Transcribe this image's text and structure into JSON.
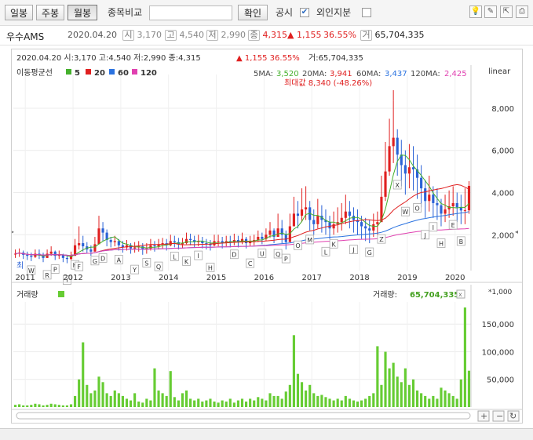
{
  "toolbar": {
    "tabs": [
      "일봉",
      "주봉",
      "월봉"
    ],
    "active_tab": "월봉",
    "compare_label": "종목비교",
    "compare_value": "",
    "confirm_label": "확인",
    "disclosure_label": "공시",
    "disclosure_checked": "✔",
    "foreign_label": "외인지분"
  },
  "quote": {
    "name": "우수AMS",
    "date": "2020.04.20",
    "open_icon": "시",
    "open": "3,170",
    "high_icon": "고",
    "high": "4,540",
    "low_icon": "저",
    "low": "2,990",
    "close_icon": "종",
    "close": "4,315",
    "change": "▲ 1,155",
    "change_pct": "36.55%",
    "volume_icon": "거",
    "volume": "65,704,335"
  },
  "chart_header": {
    "line": "2020.04.20  시:3,170  고:4,540  저:2,990  종:4,315",
    "change": "▲ 1,155  36.55%",
    "volume": "거:65,704,335",
    "ma_title": "이동평균선",
    "ma_legend": [
      "5",
      "20",
      "60",
      "120"
    ],
    "ma_values": [
      {
        "label": "5MA:",
        "value": "3,520"
      },
      {
        "label": "20MA:",
        "value": "3,941"
      },
      {
        "label": "60MA:",
        "value": "3,437"
      },
      {
        "label": "120MA:",
        "value": "2,425"
      }
    ],
    "max_label": "최대값 8,340 (-48.26%)",
    "min_label": "최",
    "scale": "linear",
    "volume_title": "거래량",
    "volume_value_label": "거래량:",
    "volume_value": "65,704,335",
    "volume_unit": "*1,000"
  },
  "colors": {
    "up": "#e02020",
    "down": "#2a62d6",
    "ma5": "#44b02c",
    "ma20": "#e02020",
    "ma60": "#2a72e0",
    "ma120": "#e040b0",
    "volume": "#66cc33"
  },
  "chart_data": [
    {
      "type": "candlestick",
      "title": "",
      "x_tick_labels": [
        "2011",
        "2012",
        "2013",
        "2014",
        "2015",
        "2016",
        "2017",
        "2018",
        "2019",
        "2020"
      ],
      "y_tick_labels": [
        "2,000",
        "4,000",
        "6,000",
        "8,000"
      ],
      "ylim": [
        300,
        9300
      ],
      "scale": "linear",
      "grid": true,
      "months": [
        "2010-10",
        "2010-11",
        "2010-12",
        "2011-01",
        "2011-02",
        "2011-03",
        "2011-04",
        "2011-05",
        "2011-06",
        "2011-07",
        "2011-08",
        "2011-09",
        "2011-10",
        "2011-11",
        "2011-12",
        "2012-01",
        "2012-02",
        "2012-03",
        "2012-04",
        "2012-05",
        "2012-06",
        "2012-07",
        "2012-08",
        "2012-09",
        "2012-10",
        "2012-11",
        "2012-12",
        "2013-01",
        "2013-02",
        "2013-03",
        "2013-04",
        "2013-05",
        "2013-06",
        "2013-07",
        "2013-08",
        "2013-09",
        "2013-10",
        "2013-11",
        "2013-12",
        "2014-01",
        "2014-02",
        "2014-03",
        "2014-04",
        "2014-05",
        "2014-06",
        "2014-07",
        "2014-08",
        "2014-09",
        "2014-10",
        "2014-11",
        "2014-12",
        "2015-01",
        "2015-02",
        "2015-03",
        "2015-04",
        "2015-05",
        "2015-06",
        "2015-07",
        "2015-08",
        "2015-09",
        "2015-10",
        "2015-11",
        "2015-12",
        "2016-01",
        "2016-02",
        "2016-03",
        "2016-04",
        "2016-05",
        "2016-06",
        "2016-07",
        "2016-08",
        "2016-09",
        "2016-10",
        "2016-11",
        "2016-12",
        "2017-01",
        "2017-02",
        "2017-03",
        "2017-04",
        "2017-05",
        "2017-06",
        "2017-07",
        "2017-08",
        "2017-09",
        "2017-10",
        "2017-11",
        "2017-12",
        "2018-01",
        "2018-02",
        "2018-03",
        "2018-04",
        "2018-05",
        "2018-06",
        "2018-07",
        "2018-08",
        "2018-09",
        "2018-10",
        "2018-11",
        "2018-12",
        "2019-01",
        "2019-02",
        "2019-03",
        "2019-04",
        "2019-05",
        "2019-06",
        "2019-07",
        "2019-08",
        "2019-09",
        "2019-10",
        "2019-11",
        "2019-12",
        "2020-01",
        "2020-02",
        "2020-03",
        "2020-04"
      ],
      "close": [
        1100,
        1150,
        1050,
        1000,
        950,
        1100,
        1050,
        900,
        1100,
        1200,
        1000,
        1050,
        900,
        850,
        1000,
        1500,
        1600,
        1450,
        1300,
        1200,
        1550,
        2300,
        2100,
        1750,
        1650,
        1700,
        1500,
        1400,
        1500,
        1350,
        1400,
        1450,
        1300,
        1350,
        1500,
        1450,
        1550,
        1600,
        1500,
        1700,
        1650,
        1550,
        1600,
        1800,
        1750,
        1650,
        1700,
        1600,
        1550,
        1500,
        1700,
        1700,
        1600,
        1700,
        1650,
        1750,
        1650,
        1800,
        1600,
        1700,
        1750,
        1900,
        1800,
        2000,
        2200,
        1900,
        2300,
        2000,
        1650,
        2400,
        3000,
        2900,
        3200,
        3300,
        2700,
        2500,
        2900,
        2700,
        2600,
        2300,
        2500,
        2600,
        2800,
        3100,
        2900,
        2700,
        2600,
        2400,
        2300,
        2200,
        2500,
        2600,
        3800,
        5000,
        6200,
        6600,
        5800,
        5300,
        4900,
        5200,
        5100,
        4700,
        4200,
        3600,
        3900,
        3500,
        3400,
        3000,
        3200,
        3350,
        3500,
        3300,
        3150,
        3160,
        4315
      ],
      "high": [
        1300,
        1350,
        1250,
        1200,
        1150,
        1300,
        1300,
        1150,
        1300,
        1450,
        1250,
        1250,
        1100,
        1050,
        1200,
        1800,
        2400,
        1950,
        1650,
        1500,
        1900,
        2900,
        2600,
        2250,
        1900,
        1950,
        1800,
        1700,
        1750,
        1600,
        1650,
        1700,
        1600,
        1600,
        1800,
        1700,
        1800,
        1850,
        1800,
        2000,
        1950,
        1850,
        1850,
        2100,
        2050,
        1950,
        2000,
        1900,
        1800,
        1750,
        2000,
        2000,
        1900,
        1950,
        1950,
        2050,
        1950,
        2100,
        1900,
        1950,
        2000,
        2200,
        2100,
        2300,
        2600,
        2300,
        3000,
        2700,
        2200,
        3000,
        3800,
        3600,
        4200,
        4300,
        3600,
        3200,
        3700,
        3400,
        3200,
        2900,
        3100,
        3300,
        3500,
        3900,
        3600,
        3300,
        3200,
        2900,
        2800,
        2700,
        3000,
        3100,
        4800,
        6400,
        7500,
        8340,
        7000,
        6500,
        6000,
        6300,
        6200,
        5800,
        5300,
        4600,
        4800,
        4300,
        4200,
        3700,
        3900,
        4100,
        4300,
        4000,
        3900,
        4200,
        4540
      ],
      "low": [
        900,
        950,
        850,
        800,
        750,
        900,
        850,
        700,
        900,
        1000,
        800,
        850,
        700,
        650,
        800,
        1000,
        1300,
        1200,
        1100,
        1000,
        1200,
        1800,
        1700,
        1450,
        1400,
        1450,
        1250,
        1150,
        1250,
        1100,
        1150,
        1200,
        1050,
        1100,
        1250,
        1200,
        1300,
        1350,
        1250,
        1450,
        1400,
        1300,
        1350,
        1550,
        1500,
        1400,
        1450,
        1350,
        1300,
        1250,
        1450,
        1450,
        1350,
        1450,
        1400,
        1500,
        1400,
        1550,
        1350,
        1450,
        1500,
        1650,
        1550,
        1700,
        1850,
        1600,
        1900,
        1600,
        1300,
        1900,
        2400,
        2300,
        2600,
        2700,
        2200,
        2000,
        2300,
        2100,
        2000,
        1800,
        2000,
        2100,
        2200,
        2500,
        2300,
        2100,
        2000,
        1800,
        1700,
        1600,
        1900,
        2000,
        2600,
        3600,
        4800,
        5400,
        4800,
        4300,
        3900,
        4200,
        4100,
        3700,
        3300,
        2800,
        3100,
        2800,
        2700,
        2400,
        2600,
        2800,
        2900,
        2600,
        2500,
        2500,
        2990
      ],
      "labels": [
        {
          "i": 4,
          "t": "W"
        },
        {
          "i": 8,
          "t": "R"
        },
        {
          "i": 10,
          "t": "P"
        },
        {
          "i": 13,
          "t": "I"
        },
        {
          "i": 15,
          "t": "H"
        },
        {
          "i": 16,
          "t": "F"
        },
        {
          "i": 20,
          "t": "G"
        },
        {
          "i": 22,
          "t": "D"
        },
        {
          "i": 26,
          "t": "A"
        },
        {
          "i": 30,
          "t": "Y"
        },
        {
          "i": 33,
          "t": "S"
        },
        {
          "i": 36,
          "t": "Q"
        },
        {
          "i": 40,
          "t": "L"
        },
        {
          "i": 43,
          "t": "K"
        },
        {
          "i": 46,
          "t": "I"
        },
        {
          "i": 49,
          "t": "H"
        },
        {
          "i": 55,
          "t": "D"
        },
        {
          "i": 59,
          "t": "C"
        },
        {
          "i": 62,
          "t": "U"
        },
        {
          "i": 66,
          "t": "Q"
        },
        {
          "i": 68,
          "t": "P"
        },
        {
          "i": 71,
          "t": "O"
        },
        {
          "i": 74,
          "t": "M"
        },
        {
          "i": 78,
          "t": "L"
        },
        {
          "i": 80,
          "t": "K"
        },
        {
          "i": 85,
          "t": "J"
        },
        {
          "i": 89,
          "t": "G"
        },
        {
          "i": 92,
          "t": "Z"
        },
        {
          "i": 96,
          "t": "X"
        },
        {
          "i": 98,
          "t": "W"
        },
        {
          "i": 101,
          "t": "O"
        },
        {
          "i": 103,
          "t": "J"
        },
        {
          "i": 105,
          "t": "I"
        },
        {
          "i": 107,
          "t": "H"
        },
        {
          "i": 110,
          "t": "E"
        },
        {
          "i": 112,
          "t": "B"
        }
      ]
    },
    {
      "type": "bar",
      "title": "",
      "ylabel": "",
      "y_tick_labels": [
        "50,000",
        "100,000",
        "150,000"
      ],
      "ylim": [
        0,
        190000
      ],
      "unit": "*1,000",
      "values": [
        4000,
        5000,
        3000,
        3000,
        4000,
        6000,
        5000,
        3000,
        4000,
        6000,
        5000,
        4000,
        3000,
        3000,
        5000,
        20000,
        50000,
        117000,
        40000,
        25000,
        30000,
        55000,
        45000,
        25000,
        20000,
        30000,
        25000,
        20000,
        15000,
        12000,
        25000,
        10000,
        8000,
        15000,
        12000,
        70000,
        30000,
        25000,
        20000,
        65000,
        18000,
        12000,
        25000,
        30000,
        15000,
        12000,
        15000,
        10000,
        12000,
        15000,
        10000,
        8000,
        12000,
        10000,
        15000,
        8000,
        12000,
        15000,
        10000,
        15000,
        12000,
        18000,
        15000,
        12000,
        25000,
        20000,
        20000,
        15000,
        28000,
        40000,
        130000,
        60000,
        45000,
        30000,
        40000,
        25000,
        20000,
        22000,
        18000,
        15000,
        12000,
        15000,
        12000,
        20000,
        15000,
        12000,
        10000,
        12000,
        15000,
        20000,
        25000,
        110000,
        40000,
        100000,
        70000,
        80000,
        55000,
        45000,
        70000,
        40000,
        50000,
        30000,
        25000,
        20000,
        15000,
        20000,
        15000,
        35000,
        30000,
        25000,
        20000,
        15000,
        50000,
        180000,
        65704
      ]
    }
  ]
}
